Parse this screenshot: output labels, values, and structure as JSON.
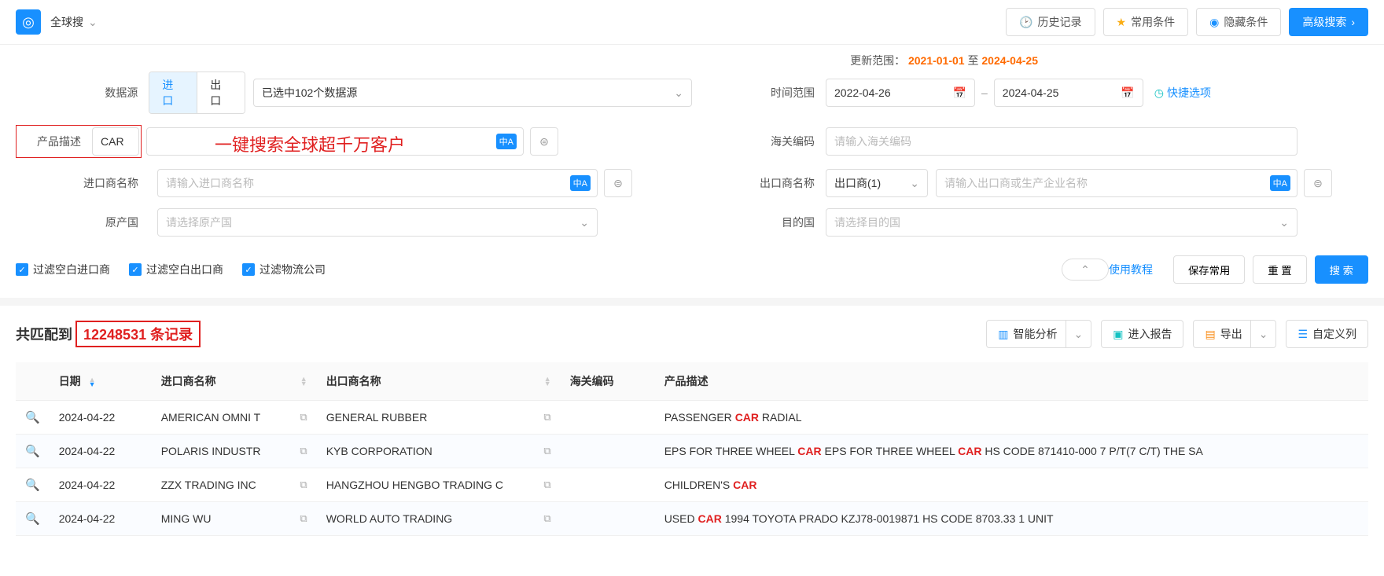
{
  "top": {
    "title": "全球搜",
    "history": "历史记录",
    "frequent": "常用条件",
    "hidden": "隐藏条件",
    "advanced": "高级搜索"
  },
  "updateRange": {
    "label": "更新范围：",
    "from": "2021-01-01",
    "to_word": "至",
    "to": "2024-04-25"
  },
  "labels": {
    "dataSource": "数据源",
    "import": "进口",
    "export": "出口",
    "dsSelected": "已选中102个数据源",
    "timeRange": "时间范围",
    "dateFrom": "2022-04-26",
    "dateTo": "2024-04-25",
    "quick": "快捷选项",
    "productDesc": "产品描述",
    "productValue": "CAR",
    "productHint": "一键搜索全球超千万客户",
    "hsCode": "海关编码",
    "hsPlaceholder": "请输入海关编码",
    "importer": "进口商名称",
    "importerPh": "请输入进口商名称",
    "exporter": "出口商名称",
    "exporterSel": "出口商(1)",
    "exporterPh": "请输入出口商或生产企业名称",
    "origin": "原产国",
    "originPh": "请选择原产国",
    "dest": "目的国",
    "destPh": "请选择目的国"
  },
  "checks": {
    "blankImporter": "过滤空白进口商",
    "blankExporter": "过滤空白出口商",
    "logistics": "过滤物流公司"
  },
  "actions": {
    "tutorial": "使用教程",
    "saveFreq": "保存常用",
    "reset": "重 置",
    "search": "搜 索"
  },
  "results": {
    "prefix": "共匹配到",
    "count": "12248531",
    "suffix": "条记录",
    "analysis": "智能分析",
    "addReport": "进入报告",
    "export": "导出",
    "customCols": "自定义列"
  },
  "columns": {
    "date": "日期",
    "importer": "进口商名称",
    "exporter": "出口商名称",
    "hs": "海关编码",
    "desc": "产品描述"
  },
  "rows": [
    {
      "date": "2024-04-22",
      "importer": "AMERICAN OMNI T",
      "exporter": "GENERAL RUBBER",
      "hs": "",
      "desc": [
        "PASSENGER ",
        "CAR",
        " RADIAL"
      ]
    },
    {
      "date": "2024-04-22",
      "importer": "POLARIS INDUSTR",
      "exporter": "KYB CORPORATION",
      "hs": "",
      "desc": [
        "EPS FOR THREE WHEEL ",
        "CAR",
        " EPS FOR THREE WHEEL ",
        "CAR",
        " HS CODE 871410-000 7 P/T(7 C/T) THE SA"
      ]
    },
    {
      "date": "2024-04-22",
      "importer": "ZZX TRADING INC",
      "exporter": "HANGZHOU HENGBO TRADING C",
      "hs": "",
      "desc": [
        "CHILDREN'S ",
        "CAR"
      ]
    },
    {
      "date": "2024-04-22",
      "importer": "MING WU",
      "exporter": "WORLD AUTO TRADING",
      "hs": "",
      "desc": [
        "USED ",
        "CAR",
        " 1994 TOYOTA PRADO KZJ78-0019871 HS CODE 8703.33 1 UNIT"
      ]
    }
  ]
}
